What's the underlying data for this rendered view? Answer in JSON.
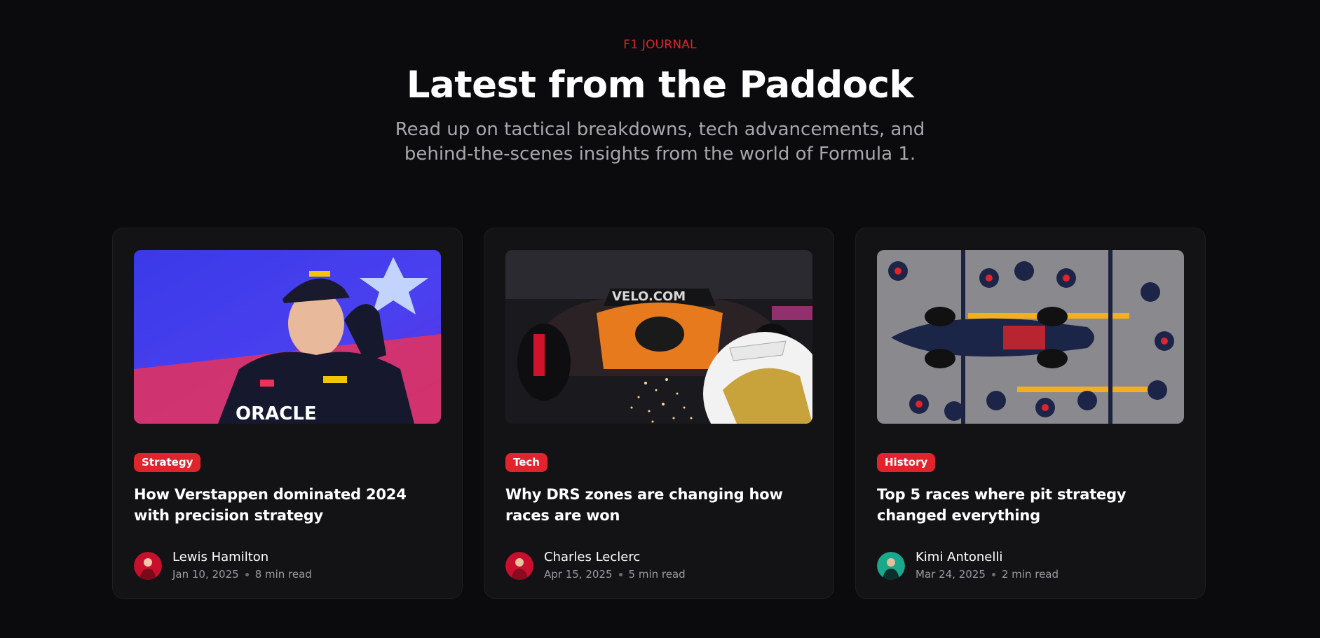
{
  "header": {
    "eyebrow": "F1 JOURNAL",
    "title": "Latest from the Paddock",
    "subtitle": "Read up on tactical breakdowns, tech advancements, and behind-the-scenes insights from the world of Formula 1."
  },
  "colors": {
    "accent": "#e0242b",
    "background": "#0b0b0d",
    "card": "#131316",
    "muted": "#9a9aa2"
  },
  "articles": [
    {
      "tag": "Strategy",
      "title": "How Verstappen dominated 2024 with precision strategy",
      "author": "Lewis Hamilton",
      "date": "Jan 10, 2025",
      "read_time": "8 min read",
      "image_icon": "driver-podium-photo",
      "avatar_color": "#c8102e"
    },
    {
      "tag": "Tech",
      "title": "Why DRS zones are changing how races are won",
      "author": "Charles Leclerc",
      "date": "Apr 15, 2025",
      "read_time": "5 min read",
      "image_icon": "car-sparks-photo",
      "avatar_color": "#c8102e"
    },
    {
      "tag": "History",
      "title": "Top 5 races where pit strategy changed everything",
      "author": "Kimi Antonelli",
      "date": "Mar 24, 2025",
      "read_time": "2 min read",
      "image_icon": "pit-stop-photo",
      "avatar_color": "#1aa88c"
    }
  ]
}
